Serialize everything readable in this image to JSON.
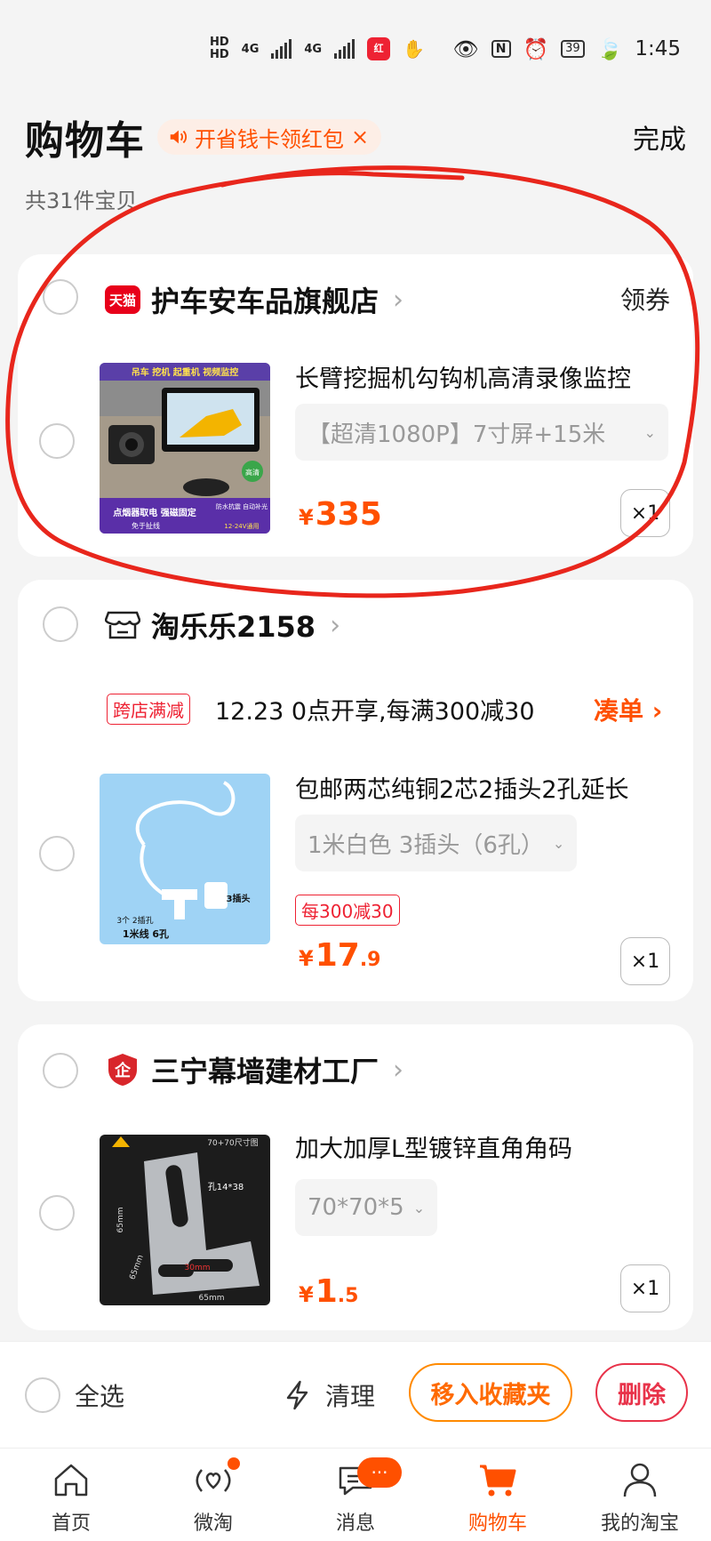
{
  "status_bar": {
    "hd1": "HD",
    "hd2": "HD",
    "net1": "4G",
    "net2": "4G",
    "battery": "39",
    "time": "1:45"
  },
  "header": {
    "title": "购物车",
    "promo_text": "开省钱卡领红包",
    "promo_close": "×",
    "done": "完成",
    "count_text": "共31件宝贝"
  },
  "shops": [
    {
      "name": "护车安车品旗舰店",
      "badge": "天猫",
      "coupon": "领券",
      "item": {
        "name": "长臂挖掘机勾钩机高清录像监控",
        "sku": "【超清1080P】7寸屏+15米",
        "price_int": "335",
        "price_dec": "",
        "qty": "×1",
        "image_text": {
          "top": "吊车 挖机 起重机 视频监控",
          "hd": "高清",
          "bottom1": "点烟器取电 强磁固定",
          "bottom2": "免于扯线",
          "waterproof": "防水抗震 自动补光",
          "voltage": "12-24V通用"
        }
      }
    },
    {
      "name": "淘乐乐2158",
      "promo_tag": "跨店满减",
      "promo_text": "12.23 0点开享,每满300减30",
      "gather": "凑单",
      "item": {
        "name": "包邮两芯纯铜2芯2插头2孔延长",
        "sku": "1米白色 3插头（6孔）",
        "tag": "每300减30",
        "price_int": "17",
        "price_dec": ".9",
        "qty": "×1",
        "image_text": {
          "a": "3个 2插孔",
          "b": "3插头",
          "c": "1米线  6孔"
        }
      }
    },
    {
      "name": "三宁幕墙建材工厂",
      "item": {
        "name": "加大加厚L型镀锌直角角码",
        "sku": "70*70*5",
        "price_int": "1",
        "price_dec": ".5",
        "qty": "×1",
        "image_text": {
          "title": "70+70尺寸图",
          "hole": "孔14*38",
          "d1": "65mm",
          "d2": "65mm",
          "d3": "30mm",
          "d4": "65mm"
        }
      }
    }
  ],
  "bottom_bar": {
    "select_all": "全选",
    "clean": "清理",
    "move_fav": "移入收藏夹",
    "delete": "删除"
  },
  "currency": "¥",
  "tabs": [
    {
      "label": "首页"
    },
    {
      "label": "微淘"
    },
    {
      "label": "消息",
      "badge": "···"
    },
    {
      "label": "购物车"
    },
    {
      "label": "我的淘宝"
    }
  ],
  "colors": {
    "accent": "#ff5000",
    "annotation": "#e8261c"
  }
}
